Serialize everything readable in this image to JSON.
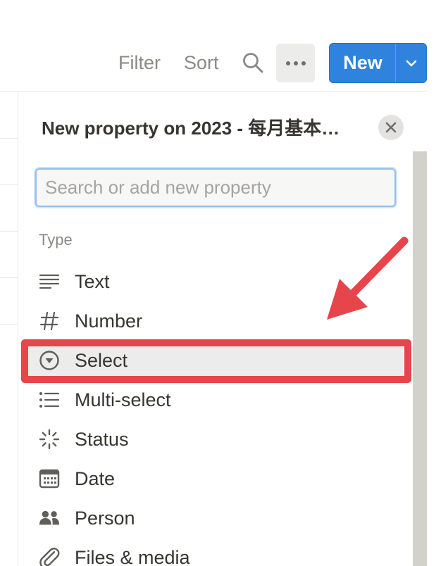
{
  "toolbar": {
    "filter_label": "Filter",
    "sort_label": "Sort",
    "search_icon": "search-icon",
    "more_icon": "ellipsis-icon",
    "new_label": "New",
    "new_dropdown_icon": "chevron-down-icon",
    "accent_color": "#2f83dd"
  },
  "panel": {
    "title": "New property on 2023 - 每月基本…",
    "close_icon": "close-icon",
    "search": {
      "placeholder": "Search or add new property",
      "value": ""
    },
    "section_label": "Type",
    "types": [
      {
        "label": "Text",
        "icon": "text-lines-icon"
      },
      {
        "label": "Number",
        "icon": "hash-icon"
      },
      {
        "label": "Select",
        "icon": "select-circle-icon",
        "selected": true
      },
      {
        "label": "Multi-select",
        "icon": "list-icon"
      },
      {
        "label": "Status",
        "icon": "status-spinner-icon"
      },
      {
        "label": "Date",
        "icon": "calendar-icon"
      },
      {
        "label": "Person",
        "icon": "people-icon"
      },
      {
        "label": "Files & media",
        "icon": "paperclip-icon"
      }
    ]
  },
  "annotation": {
    "highlight_color": "#e5454b",
    "arrow_icon": "red-arrow-icon"
  }
}
